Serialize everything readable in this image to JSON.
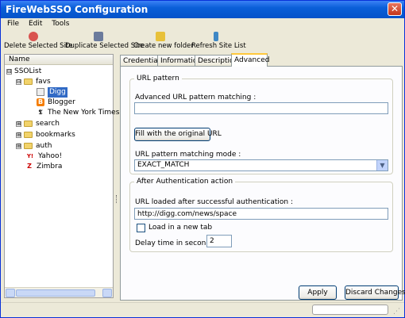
{
  "window": {
    "title": "FireWebSSO Configuration",
    "close_glyph": "✕"
  },
  "menu": [
    "File",
    "Edit",
    "Tools"
  ],
  "toolbar": {
    "buttons": [
      {
        "label": "Delete Selected Site",
        "icon": "delete-icon",
        "color": "#d9534f"
      },
      {
        "label": "Duplicate Selected Site",
        "icon": "duplicate-icon",
        "color": "#6b7b9c"
      },
      {
        "label": "Create new folder",
        "icon": "new-folder-icon",
        "color": "#e8c13a"
      },
      {
        "label": "Refresh Site List",
        "icon": "refresh-icon",
        "color": "#3f88c5"
      }
    ]
  },
  "tree": {
    "header": "Name",
    "nodes": [
      {
        "label": "SSOList",
        "expander": "⊟"
      },
      {
        "label": "favs",
        "expander": "⊟"
      },
      {
        "label": "Digg",
        "selected": true
      },
      {
        "label": "Blogger",
        "icon_glyph": "B"
      },
      {
        "label": "The New York Times",
        "icon_glyph": "𝕿"
      },
      {
        "label": "search",
        "expander": "⊞"
      },
      {
        "label": "bookmarks",
        "expander": "⊞"
      },
      {
        "label": "auth",
        "expander": "⊞"
      },
      {
        "label": "Yahoo!",
        "icon_glyph": "Y!"
      },
      {
        "label": "Zimbra",
        "icon_glyph": "Z"
      }
    ]
  },
  "tabs": [
    {
      "label": "Credentials"
    },
    {
      "label": "Information"
    },
    {
      "label": "Description"
    },
    {
      "label": "Advanced",
      "active": true
    }
  ],
  "url_pattern": {
    "legend": "URL pattern",
    "field_label": "Advanced URL pattern matching :",
    "field_value": "",
    "fill_button": "Fill with the original URL",
    "mode_label": "URL pattern matching mode :",
    "mode_value": "EXACT_MATCH"
  },
  "after_auth": {
    "legend": "After Authentication action",
    "url_label": "URL loaded after successful authentication :",
    "url_value": "http://digg.com/news/space",
    "new_tab_label": "Load in a new tab",
    "new_tab_checked": false,
    "delay_label": "Delay time in seconds :",
    "delay_value": "2"
  },
  "footer": {
    "apply": "Apply",
    "discard": "Discard Changes"
  }
}
